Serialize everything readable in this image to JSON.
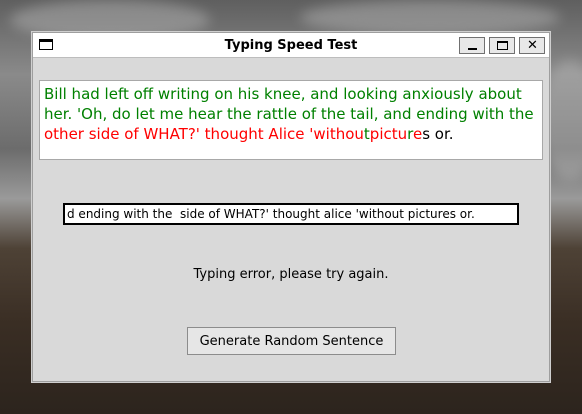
{
  "window": {
    "title": "Typing Speed Test",
    "close_glyph": "✕"
  },
  "colors": {
    "correct": "#008000",
    "incorrect": "#ff0000",
    "untyped": "#000000"
  },
  "sentence": {
    "segments": [
      {
        "text": "Bill had left off writing on his knee, and looking anxiously about her. 'Oh, do let me hear the rattle of the tail, and ending with the ",
        "state": "correct"
      },
      {
        "text": "other side of WHAT?' thought Alice 'withou",
        "state": "incorrect"
      },
      {
        "text": "t",
        "state": "correct"
      },
      {
        "text": "pictu",
        "state": "incorrect"
      },
      {
        "text": "r",
        "state": "correct"
      },
      {
        "text": "e",
        "state": "incorrect"
      },
      {
        "text": "s or.",
        "state": "untyped"
      }
    ]
  },
  "input": {
    "value": "d ending with the  side of WHAT?' thought alice 'without pictures or."
  },
  "status": {
    "message": "Typing error, please try again."
  },
  "buttons": {
    "generate_label": "Generate Random Sentence"
  },
  "icons": {
    "app": "window-icon",
    "minimize": "minimize-icon",
    "maximize": "maximize-icon",
    "close": "close-icon"
  }
}
